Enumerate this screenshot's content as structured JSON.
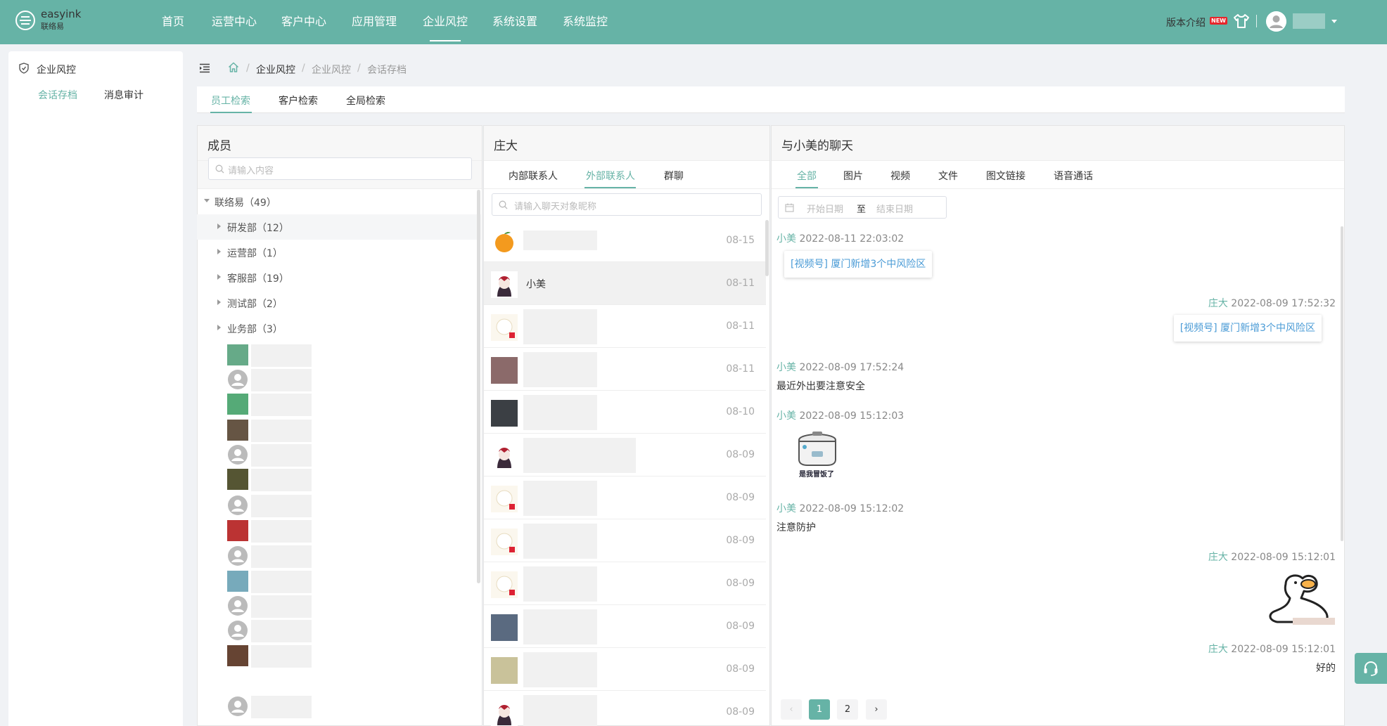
{
  "brand": {
    "name": "easyink",
    "sub": "联络易"
  },
  "nav": [
    "首页",
    "运营中心",
    "客户中心",
    "应用管理",
    "企业风控",
    "系统设置",
    "系统监控"
  ],
  "nav_active": "企业风控",
  "header": {
    "version_label": "版本介绍",
    "new_badge": "NEW"
  },
  "colors": {
    "primary": "#66b3a6",
    "link": "#4a9bd6"
  },
  "sidebar": {
    "title": "企业风控",
    "items": [
      "会话存档",
      "消息审计"
    ],
    "active": "会话存档"
  },
  "breadcrumb": [
    "企业风控",
    "企业风控",
    "会话存档"
  ],
  "tabs": [
    "员工检索",
    "客户检索",
    "全局检索"
  ],
  "tabs_active": "员工检索",
  "members": {
    "title": "成员",
    "search_placeholder": "请输入内容",
    "root": "联络易（49）",
    "departments": [
      "研发部（12）",
      "运营部（1）",
      "客服部（19）",
      "测试部（2）",
      "业务部（3）"
    ]
  },
  "contacts": {
    "title": "庄大",
    "tabs": [
      "内部联系人",
      "外部联系人",
      "群聊"
    ],
    "active_tab": "外部联系人",
    "search_placeholder": "请输入聊天对象昵称",
    "rows": [
      {
        "name": "",
        "date": "08-15",
        "avatar": "orange-avatar"
      },
      {
        "name": "小美",
        "date": "08-11",
        "avatar": "cartoon-avatar"
      },
      {
        "name": "",
        "date": "08-11",
        "avatar": "anime-avatar"
      },
      {
        "name": "",
        "date": "08-11",
        "avatar": "photo-avatar"
      },
      {
        "name": "",
        "date": "08-10",
        "avatar": "dark-photo-avatar"
      },
      {
        "name": "",
        "date": "08-09",
        "avatar": "cartoon-avatar"
      },
      {
        "name": "",
        "date": "08-09",
        "avatar": "anime-avatar"
      },
      {
        "name": "",
        "date": "08-09",
        "avatar": "anime-avatar"
      },
      {
        "name": "",
        "date": "08-09",
        "avatar": "anime-avatar"
      },
      {
        "name": "",
        "date": "08-09",
        "avatar": "child-photo-avatar"
      },
      {
        "name": "",
        "date": "08-09",
        "avatar": "cat-avatar"
      },
      {
        "name": "",
        "date": "08-09",
        "avatar": "cartoon-avatar"
      }
    ]
  },
  "chat": {
    "title": "与小美的聊天",
    "tabs": [
      "全部",
      "图片",
      "视频",
      "文件",
      "图文链接",
      "语音通话"
    ],
    "active_tab": "全部",
    "date_start_placeholder": "开始日期",
    "date_sep": "至",
    "date_end_placeholder": "结束日期",
    "messages": [
      {
        "sender": "小美",
        "time": "2022-08-11 22:03:02",
        "type": "link",
        "content": "[视频号] 厦门新增3个中风险区"
      },
      {
        "sender": "庄大",
        "time": "2022-08-09 17:52:32",
        "type": "link",
        "content": "[视频号] 厦门新增3个中风险区"
      },
      {
        "sender": "小美",
        "time": "2022-08-09 17:52:24",
        "type": "text",
        "content": "最近外出要注意安全"
      },
      {
        "sender": "小美",
        "time": "2022-08-09 15:12:03",
        "type": "sticker",
        "content": "是我冒饭了"
      },
      {
        "sender": "小美",
        "time": "2022-08-09 15:12:02",
        "type": "text",
        "content": "注意防护"
      },
      {
        "sender": "庄大",
        "time": "2022-08-09 15:12:01",
        "type": "sticker",
        "content": ""
      },
      {
        "sender": "庄大",
        "time": "2022-08-09 15:12:01",
        "type": "text",
        "content": "好的"
      }
    ],
    "pagination": {
      "pages": [
        "1",
        "2"
      ],
      "current": "1"
    }
  }
}
